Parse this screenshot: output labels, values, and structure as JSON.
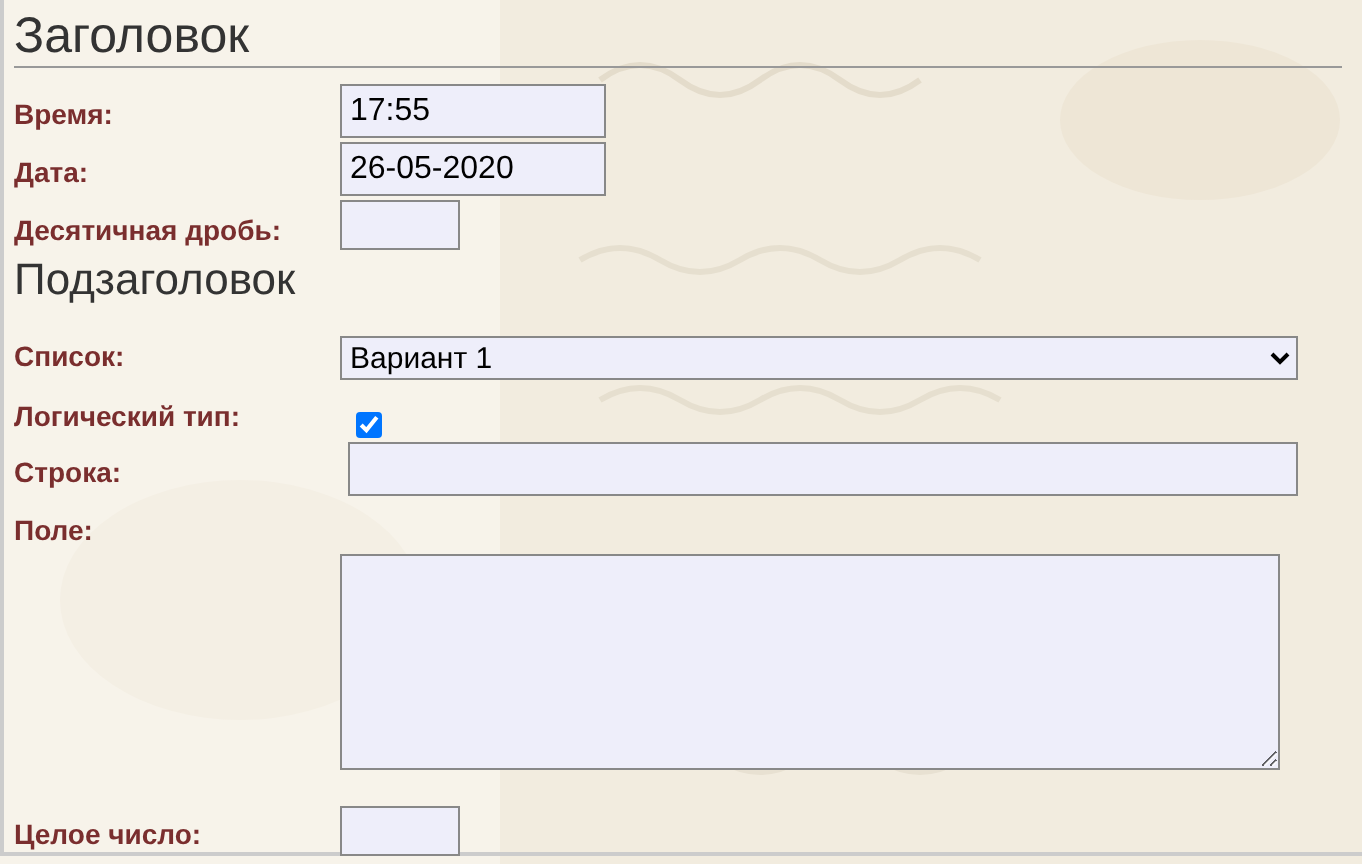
{
  "title": "Заголовок",
  "fields": [
    {
      "kind": "text",
      "label": "Время:",
      "value": "17:55"
    },
    {
      "kind": "text",
      "label": "Дата:",
      "value": "26-05-2020"
    },
    {
      "kind": "short",
      "label": "Десятичная дробь:"
    }
  ],
  "subtitle": "Подзаголовок",
  "fields2": [
    {
      "kind": "select",
      "label": "Список:",
      "value": "Вариант 1"
    },
    {
      "kind": "checkbox",
      "label": "Логический тип:",
      "checked": true
    },
    {
      "kind": "wide",
      "label": "Строка:"
    },
    {
      "kind": "textarea",
      "label": "Поле:"
    },
    {
      "kind": "short",
      "label": "Целое число:"
    }
  ]
}
